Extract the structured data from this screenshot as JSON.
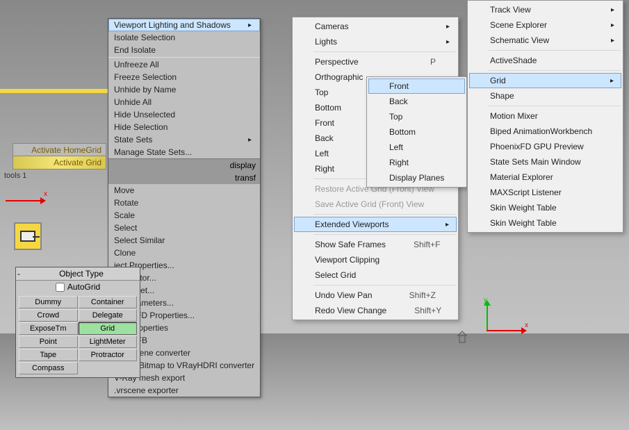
{
  "quad_labels": {
    "activate_home": "Activate HomeGrid",
    "activate_grid": "Activate Grid"
  },
  "tools_label": "tools 1",
  "display_label": "display",
  "transform_label": "transf",
  "axis": {
    "x": "x",
    "y": "y"
  },
  "main_menu_top": {
    "items": [
      {
        "label": "Viewport Lighting and Shadows",
        "sub": true,
        "hl": true
      },
      {
        "label": "Isolate Selection"
      },
      {
        "label": "End Isolate"
      }
    ]
  },
  "main_menu_mid": {
    "items": [
      {
        "label": "Unfreeze All"
      },
      {
        "label": "Freeze Selection"
      },
      {
        "label": "Unhide by Name"
      },
      {
        "label": "Unhide All"
      },
      {
        "label": "Hide Unselected"
      },
      {
        "label": "Hide Selection"
      },
      {
        "label": "State Sets",
        "sub": true
      },
      {
        "label": "Manage State Sets..."
      }
    ]
  },
  "main_menu_bot": {
    "items": [
      {
        "label": "Move"
      },
      {
        "label": "Rotate"
      },
      {
        "label": "Scale"
      },
      {
        "label": "Select"
      },
      {
        "label": "Select Similar"
      },
      {
        "label": "Clone"
      },
      {
        "label": "ject Properties..."
      },
      {
        "label": "rve Editor..."
      },
      {
        "label": "pe Sheet..."
      },
      {
        "label": "re Parameters..."
      },
      {
        "label": "oenix FD Properties..."
      },
      {
        "label": "Ray properties"
      },
      {
        "label": "Ray VFB"
      },
      {
        "label": "Ray scene converter"
      },
      {
        "label": "V-Ray Bitmap to VRayHDRI converter"
      },
      {
        "label": "V-Ray mesh export"
      },
      {
        "label": ".vrscene exporter"
      }
    ]
  },
  "view_menu": {
    "items": [
      {
        "label": "Cameras",
        "sub": true
      },
      {
        "label": "Lights",
        "sub": true
      },
      {
        "sep": true
      },
      {
        "label": "Perspective",
        "shortcut": "P"
      },
      {
        "label": "Orthographic"
      },
      {
        "label": "Top"
      },
      {
        "label": "Bottom"
      },
      {
        "label": "Front"
      },
      {
        "label": "Back"
      },
      {
        "label": "Left"
      },
      {
        "label": "Right"
      },
      {
        "sep": true
      },
      {
        "label": "Restore Active Grid (Front) View",
        "disabled": true
      },
      {
        "label": "Save Active Grid (Front) View",
        "disabled": true
      },
      {
        "sep": true
      },
      {
        "label": "Extended Viewports",
        "sub": true,
        "hl": true
      },
      {
        "sep": true
      },
      {
        "label": "Show Safe Frames",
        "shortcut": "Shift+F"
      },
      {
        "label": "Viewport Clipping"
      },
      {
        "label": "Select Grid"
      },
      {
        "sep": true
      },
      {
        "label": "Undo View Pan",
        "shortcut": "Shift+Z"
      },
      {
        "label": "Redo View Change",
        "shortcut": "Shift+Y"
      }
    ]
  },
  "orient_menu": {
    "items": [
      {
        "label": "Front",
        "hl": true
      },
      {
        "label": "Back"
      },
      {
        "label": "Top"
      },
      {
        "label": "Bottom"
      },
      {
        "label": "Left"
      },
      {
        "label": "Right"
      },
      {
        "label": "Display Planes"
      }
    ]
  },
  "tools_menu": {
    "items": [
      {
        "label": "Track View",
        "sub": true
      },
      {
        "label": "Scene Explorer",
        "sub": true
      },
      {
        "label": "Schematic View",
        "sub": true
      },
      {
        "sep": true
      },
      {
        "label": "ActiveShade"
      },
      {
        "sep": true
      },
      {
        "label": "Grid",
        "sub": true,
        "hl": true
      },
      {
        "label": "Shape"
      },
      {
        "sep": true
      },
      {
        "label": "Motion Mixer"
      },
      {
        "label": "Biped AnimationWorkbench"
      },
      {
        "label": "PhoenixFD GPU Preview"
      },
      {
        "label": "State Sets Main Window"
      },
      {
        "label": "Material Explorer"
      },
      {
        "label": "MAXScript Listener"
      },
      {
        "label": "Skin Weight Table"
      },
      {
        "label": "Skin Weight Table"
      }
    ]
  },
  "object_panel": {
    "title": "Object Type",
    "autogrid": "AutoGrid",
    "buttons": [
      {
        "label": "Dummy"
      },
      {
        "label": "Container"
      },
      {
        "label": "Crowd"
      },
      {
        "label": "Delegate"
      },
      {
        "label": "ExposeTm"
      },
      {
        "label": "Grid",
        "selected": true
      },
      {
        "label": "Point"
      },
      {
        "label": "LightMeter"
      },
      {
        "label": "Tape"
      },
      {
        "label": "Protractor"
      },
      {
        "label": "Compass"
      }
    ]
  }
}
